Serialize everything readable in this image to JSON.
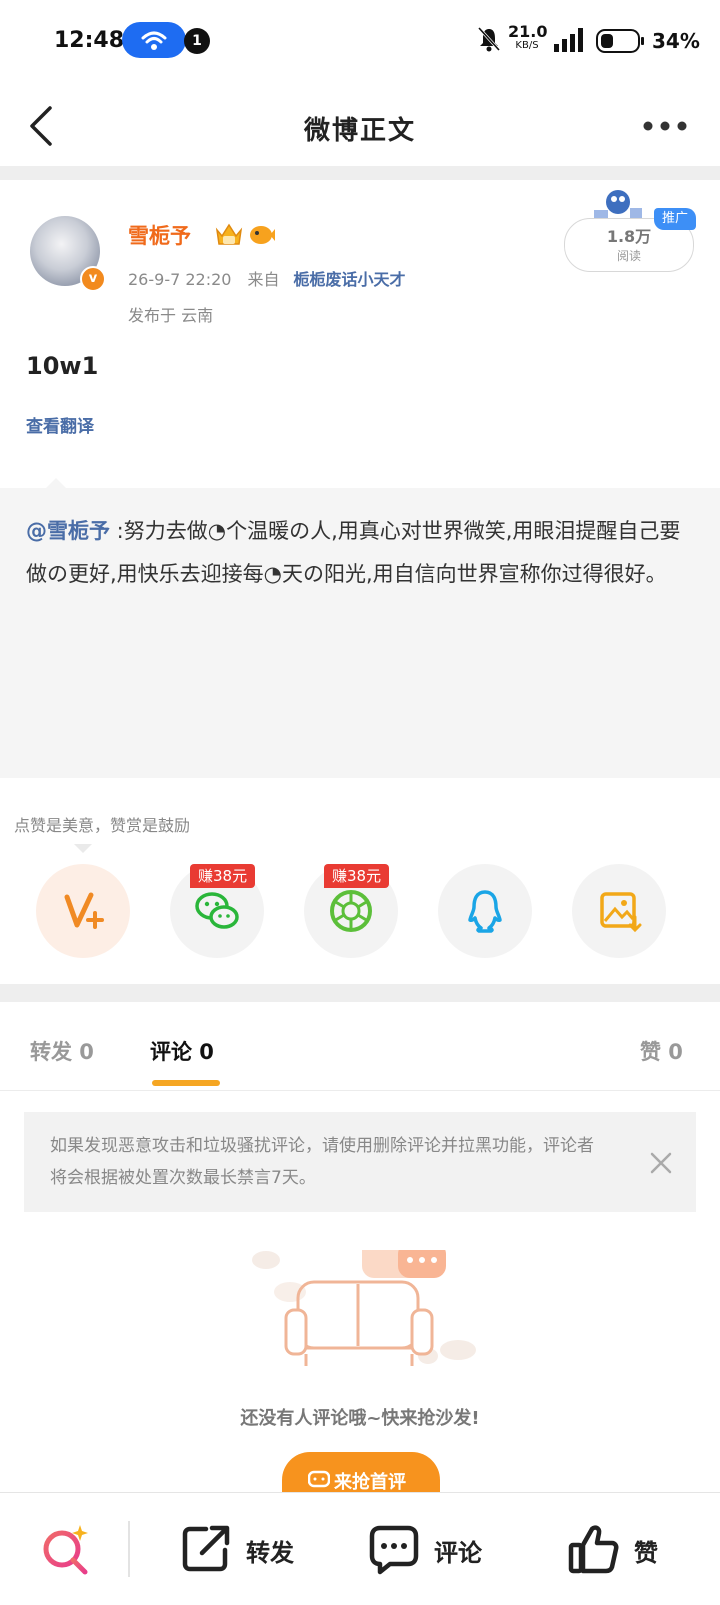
{
  "status_bar": {
    "time": "12:48",
    "notification_count": "1",
    "net_speed_value": "21.0",
    "net_speed_unit": "KB/S",
    "battery": "34%"
  },
  "nav": {
    "title": "微博正文"
  },
  "post": {
    "author": "雪栀予",
    "date": "26-9-7 22:20",
    "from_label": "来自",
    "source": "栀栀废话小天才",
    "location": "发布于 云南",
    "reads_value": "1.8万",
    "reads_label": "阅读",
    "promo_tag": "推广",
    "text": "10w1",
    "translate_label": "查看翻译"
  },
  "repost": {
    "mention": "@雪栀予",
    "text": " :努力去做◔个温暖の人,用真心对世界微笑,用眼泪提醒自己要做の更好,用快乐去迎接每◔天の阳光,用自信向世界宣称你过得很好。"
  },
  "share": {
    "tip": "点赞是美意，赞赏是鼓励",
    "earn_label_1": "赚38元",
    "earn_label_2": "赚38元",
    "items": [
      "v-plus-icon",
      "wechat-icon",
      "moments-icon",
      "qq-icon",
      "save-image-icon"
    ]
  },
  "tabs": {
    "repost": "转发 0",
    "comment": "评论 0",
    "like": "赞 0"
  },
  "notice": {
    "text": "如果发现恶意攻击和垃圾骚扰评论，请使用删除评论并拉黑功能，评论者将会根据被处置次数最长禁言7天。"
  },
  "empty_state": {
    "text": "还没有人评论哦~快来抢沙发!",
    "button": "来抢首评"
  },
  "bottom_bar": {
    "repost": "转发",
    "comment": "评论",
    "like": "赞"
  },
  "colors": {
    "accent_orange": "#f7931e",
    "author_orange": "#f06a1b",
    "link_blue": "#4a6da7",
    "earn_red": "#e93b33"
  }
}
